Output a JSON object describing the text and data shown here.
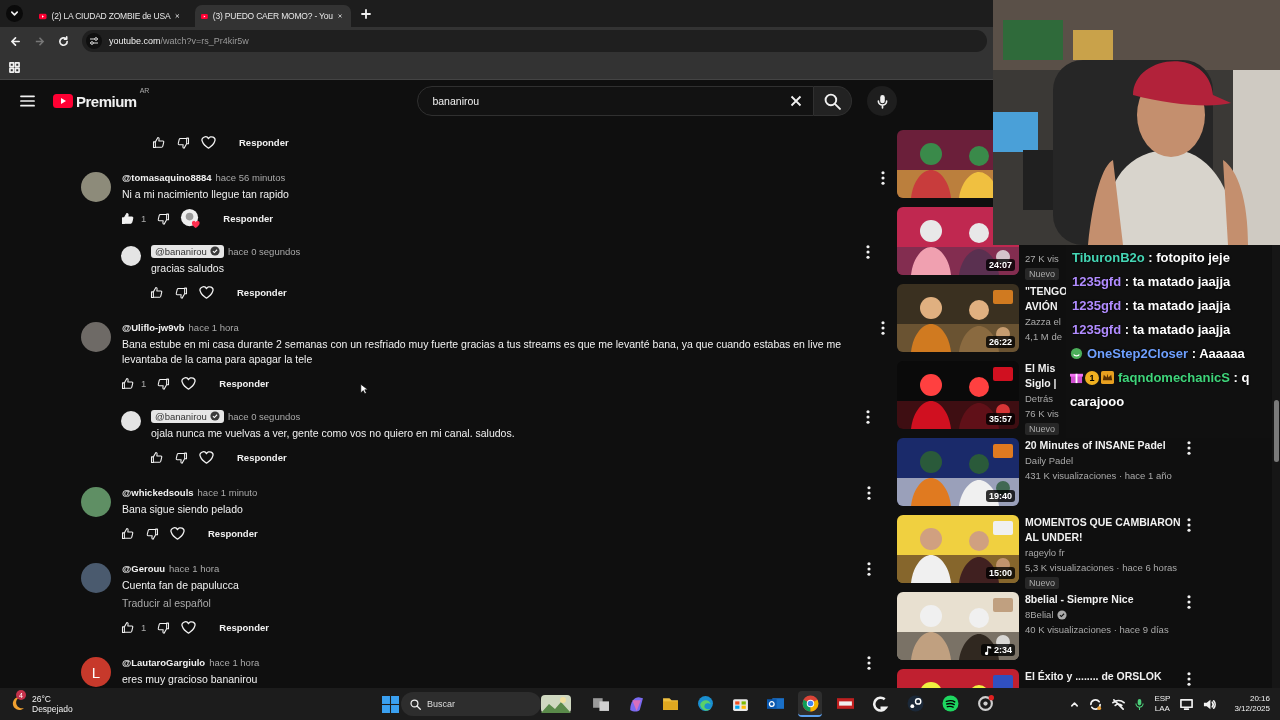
{
  "browser": {
    "tabs": [
      {
        "title": "(2) LA CIUDAD ZOMBIE de USA",
        "selected": false
      },
      {
        "title": "(3) PUEDO CAER MOMO? - You",
        "selected": true
      }
    ],
    "address": {
      "host": "youtube.com",
      "path": "/watch?v=rs_Pr4kir5w"
    }
  },
  "header": {
    "logo": "Premium",
    "region": "AR",
    "search": {
      "value": "bananirou"
    }
  },
  "comments": [
    {
      "kind": "reply_tail",
      "actions": {
        "liked": false,
        "creator_heart": false,
        "reply": "Responder"
      }
    },
    {
      "kind": "comment",
      "author": "@tomasaquino8884",
      "time": "hace 56 minutos",
      "text": "Ni a mi nacimiento llegue tan rapido",
      "avatar": {
        "color": "#8d8b7a"
      },
      "actions": {
        "likes": "1",
        "liked": true,
        "creator_heart": true,
        "reply": "Responder"
      },
      "replies": [
        {
          "author": "@bananirou",
          "owner": true,
          "verified": true,
          "time": "hace 0 segundos",
          "text": "gracias saludos",
          "avatar": {
            "color": "#e4e4e4"
          },
          "actions": {
            "liked": false,
            "creator_heart": false,
            "reply": "Responder"
          }
        }
      ]
    },
    {
      "kind": "comment",
      "author": "@Uliflo-jw9vb",
      "time": "hace 1 hora",
      "text": "Bana estube en mi casa durante 2 semanas con un resfriado muy fuerte gracias a tus streams es que me levanté bana, ya que cuando estabas en live me levantaba de la cama para apagar la tele",
      "avatar": {
        "color": "#6e6a66"
      },
      "actions": {
        "likes": "1",
        "liked": false,
        "creator_heart": false,
        "reply": "Responder"
      },
      "replies": [
        {
          "author": "@bananirou",
          "owner": true,
          "verified": true,
          "time": "hace 0 segundos",
          "text": "ojala nunca me vuelvas a ver, gente como vos no quiero en mi canal. saludos.",
          "avatar": {
            "color": "#e4e4e4"
          },
          "actions": {
            "liked": false,
            "creator_heart": false,
            "reply": "Responder"
          }
        }
      ]
    },
    {
      "kind": "comment",
      "author": "@whickedsouls",
      "time": "hace 1 minuto",
      "text": "Bana sigue siendo pelado",
      "avatar": {
        "color": "#5f8f64"
      },
      "actions": {
        "liked": false,
        "creator_heart": false,
        "reply": "Responder"
      }
    },
    {
      "kind": "comment",
      "author": "@Gerouu",
      "time": "hace 1 hora",
      "text": "Cuenta fan de papulucca",
      "translate": "Traducir al español",
      "avatar": {
        "color": "#4a5a6e"
      },
      "actions": {
        "likes": "1",
        "liked": false,
        "creator_heart": false,
        "reply": "Responder"
      }
    },
    {
      "kind": "comment",
      "author": "@LautaroGargiulo",
      "time": "hace 1 hora",
      "text": "eres muy gracioso bananirou",
      "avatar": {
        "color": "#c7392b",
        "letter": "L"
      }
    }
  ],
  "sidebar": {
    "videos": [
      {
        "kind": "covered"
      },
      {
        "duration": "24:07",
        "views": "27 K vis",
        "badge": "Nuevo"
      },
      {
        "duration": "26:22",
        "title_lines": [
          "\"TENGO",
          "AVIÓN"
        ],
        "channel": "Zazza el",
        "views": "4,1 M de"
      },
      {
        "duration": "35:57",
        "title_lines": [
          "El Mis",
          "Siglo |"
        ],
        "channel": "Detrás",
        "views": "76 K vis",
        "badge": "Nuevo"
      },
      {
        "duration": "19:40",
        "title_lines": [
          "20 Minutes of INSANE Padel"
        ],
        "channel": "Daily Padel",
        "views": "431 K visualizaciones · hace 1 año",
        "menu": true
      },
      {
        "duration": "15:00",
        "title_lines": [
          "MOMENTOS QUE CAMBIARON",
          "AL UNDER!"
        ],
        "channel": "rageylo fr",
        "views": "5,3 K visualizaciones · hace 6 horas",
        "badge": "Nuevo",
        "menu": true
      },
      {
        "duration": "2:34",
        "music": true,
        "title_lines": [
          "8belial - Siempre Nice"
        ],
        "channel": "8Belial",
        "verified": true,
        "views": "40 K visualizaciones · hace 9 días",
        "menu": true
      },
      {
        "title_lines": [
          "El Éxito y ........ de ORSLOK"
        ],
        "menu": true
      }
    ]
  },
  "chat": {
    "messages": [
      {
        "name": "TiburonB2o",
        "color": "#45d6b5",
        "text": ": fotopito jeje"
      },
      {
        "name": "1235gfd",
        "color": "#b18cff",
        "text": ": ta matado jaajja"
      },
      {
        "name": "1235gfd",
        "color": "#b18cff",
        "text": ": ta matado jaajja"
      },
      {
        "name": "1235gfd",
        "color": "#b18cff",
        "text": ": ta matado jaajja"
      },
      {
        "name": "OneStep2Closer",
        "color": "#6fa0ff",
        "text": ": Aaaaaa",
        "badges": [
          {
            "kind": "sticker"
          }
        ]
      },
      {
        "name": "faqndomechanicS",
        "color": "#3fd47a",
        "text": ": q carajooo",
        "badges": [
          {
            "kind": "gift"
          },
          {
            "kind": "coin",
            "text": "1"
          },
          {
            "kind": "crown"
          }
        ]
      }
    ]
  },
  "taskbar": {
    "weather": {
      "temp": "26°C",
      "desc": "Despejado",
      "badge": "4"
    },
    "search": {
      "placeholder": "Buscar"
    },
    "apps": [
      {
        "kind": "taskview",
        "selected": false
      },
      {
        "kind": "swirl",
        "selected": false
      },
      {
        "kind": "folder",
        "selected": false
      },
      {
        "kind": "wave",
        "selected": false
      },
      {
        "kind": "bag",
        "selected": false
      },
      {
        "kind": "mail",
        "selected": false
      },
      {
        "kind": "browser",
        "selected": true
      },
      {
        "kind": "tile",
        "selected": false
      },
      {
        "kind": "hook",
        "selected": false
      },
      {
        "kind": "disc",
        "selected": false
      },
      {
        "kind": "music",
        "selected": false
      },
      {
        "kind": "ring",
        "selected": false
      }
    ],
    "tray": {
      "lang": "ESP",
      "region": "LAA",
      "time": "20:16",
      "date": "3/12/2025"
    }
  }
}
